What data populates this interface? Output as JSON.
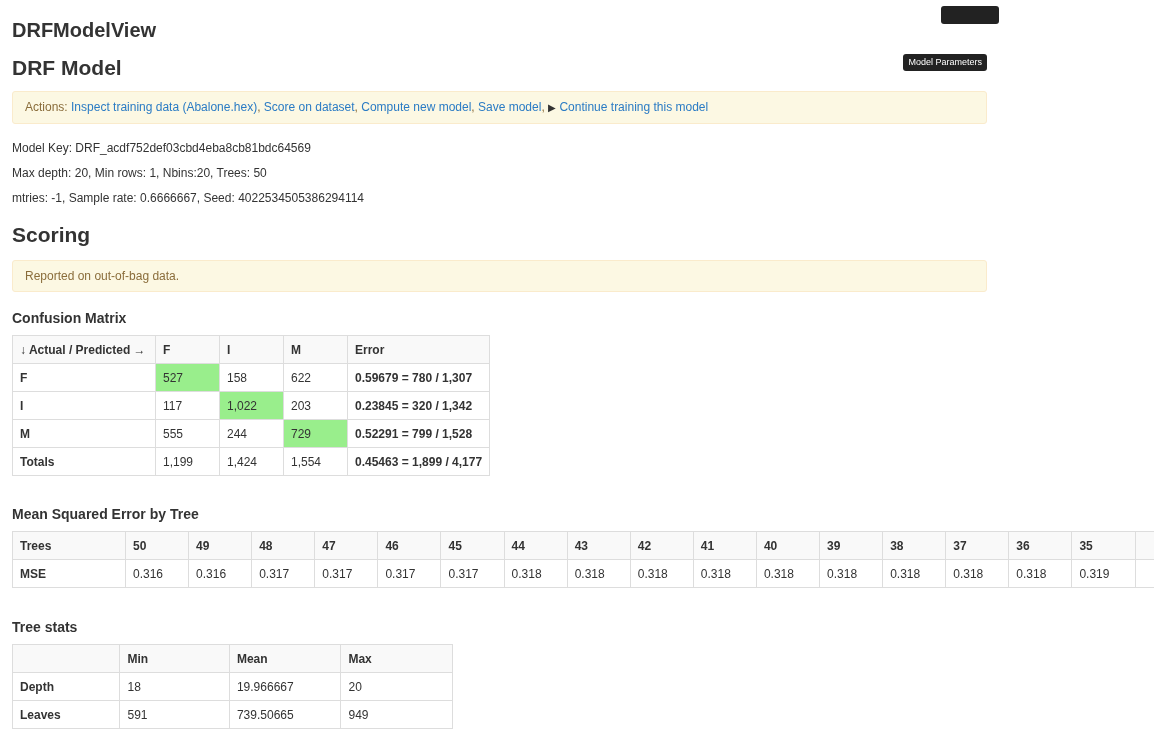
{
  "page_title": "DRFModelView",
  "model_title": "DRF Model",
  "model_parameters_button": "Model Parameters",
  "actions": {
    "label": "Actions:",
    "items": [
      {
        "kind": "link",
        "text": "Inspect training data (Abalone.hex)"
      },
      {
        "kind": "text",
        "text": ","
      },
      {
        "kind": "link",
        "text": "Score on dataset"
      },
      {
        "kind": "text",
        "text": ","
      },
      {
        "kind": "link",
        "text": "Compute new model"
      },
      {
        "kind": "text",
        "text": ","
      },
      {
        "kind": "link",
        "text": "Save model"
      },
      {
        "kind": "text",
        "text": ","
      },
      {
        "kind": "icon",
        "text": "▶"
      },
      {
        "kind": "link",
        "text": "Continue training this model"
      }
    ]
  },
  "info_lines": [
    "Model Key: DRF_acdf752def03cbd4eba8cb81bdc64569",
    "Max depth: 20, Min rows: 1, Nbins:20, Trees: 50",
    "mtries: -1, Sample rate: 0.6666667, Seed: 4022534505386294114"
  ],
  "scoring": {
    "title": "Scoring",
    "note": "Reported on out-of-bag data."
  },
  "confusion_matrix": {
    "title": "Confusion Matrix",
    "corner": "↓ Actual / Predicted →",
    "columns": [
      "F",
      "I",
      "M",
      "Error"
    ],
    "rows": [
      {
        "label": "F",
        "cells": [
          {
            "value": "527",
            "highlighted": true
          },
          {
            "value": "158",
            "highlighted": false
          },
          {
            "value": "622",
            "highlighted": false
          }
        ],
        "error": "0.59679 = 780 / 1,307"
      },
      {
        "label": "I",
        "cells": [
          {
            "value": "117",
            "highlighted": false
          },
          {
            "value": "1,022",
            "highlighted": true
          },
          {
            "value": "203",
            "highlighted": false
          }
        ],
        "error": "0.23845 = 320 / 1,342"
      },
      {
        "label": "M",
        "cells": [
          {
            "value": "555",
            "highlighted": false
          },
          {
            "value": "244",
            "highlighted": false
          },
          {
            "value": "729",
            "highlighted": true
          }
        ],
        "error": "0.52291 = 799 / 1,528"
      },
      {
        "label": "Totals",
        "cells": [
          {
            "value": "1,199",
            "highlighted": false
          },
          {
            "value": "1,424",
            "highlighted": false
          },
          {
            "value": "1,554",
            "highlighted": false
          }
        ],
        "error": "0.45463 = 1,899 / 4,177"
      }
    ]
  },
  "mse_table": {
    "title": "Mean Squared Error by Tree",
    "rows": [
      {
        "label": "Trees",
        "values": [
          "50",
          "49",
          "48",
          "47",
          "46",
          "45",
          "44",
          "43",
          "42",
          "41",
          "40",
          "39",
          "38",
          "37",
          "36",
          "35"
        ]
      },
      {
        "label": "MSE",
        "values": [
          "0.316",
          "0.316",
          "0.317",
          "0.317",
          "0.317",
          "0.317",
          "0.318",
          "0.318",
          "0.318",
          "0.318",
          "0.318",
          "0.318",
          "0.318",
          "0.318",
          "0.318",
          "0.319"
        ]
      }
    ]
  },
  "tree_stats": {
    "title": "Tree stats",
    "columns": [
      "Min",
      "Mean",
      "Max"
    ],
    "rows": [
      {
        "label": "Depth",
        "values": [
          "18",
          "19.966667",
          "20"
        ]
      },
      {
        "label": "Leaves",
        "values": [
          "591",
          "739.50665",
          "949"
        ]
      }
    ]
  }
}
